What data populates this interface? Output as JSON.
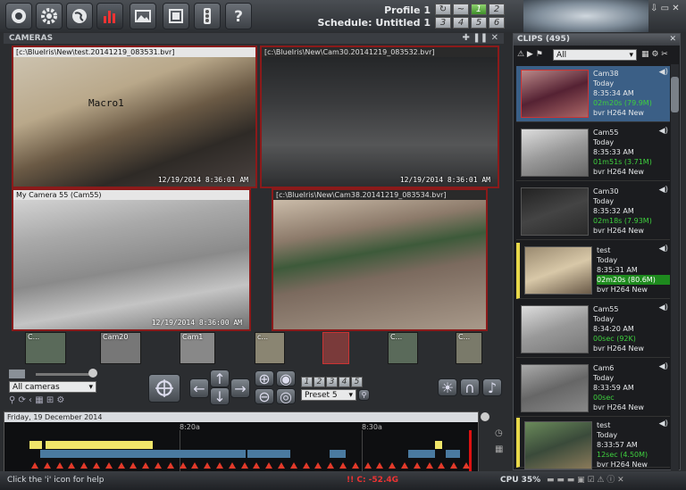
{
  "header": {
    "profile": "Profile 1",
    "schedule": "Schedule: Untitled 1",
    "profile_numbers": [
      "1",
      "2",
      "3",
      "4",
      "5",
      "6",
      "7"
    ],
    "toolbar_icons": [
      "camera-icon",
      "gear-icon",
      "globe-icon",
      "chart-icon",
      "image-icon",
      "film-icon",
      "traffic-light-icon",
      "help-icon"
    ]
  },
  "cameras": {
    "title": "CAMERAS",
    "tiles": [
      {
        "title": "[c:\\BlueIris\\New\\test.20141219_083531.bvr]",
        "stamp": "12/19/2014 8:36:01 AM",
        "overlay": "Macro1"
      },
      {
        "title": "[c:\\BlueIris\\New\\Cam30.20141219_083532.bvr]",
        "stamp": "12/19/2014 8:36:01 AM",
        "overlay": ""
      },
      {
        "title": "My Camera 55 (Cam55)",
        "stamp": "12/19/2014 8:36:00 AM",
        "overlay": ""
      },
      {
        "title": "[c:\\BlueIris\\New\\Cam38.20141219_083534.bvr]",
        "stamp": "",
        "overlay": ""
      }
    ],
    "thumbs": [
      "C...",
      "Cam20",
      "Cam1",
      "c...",
      "",
      "",
      "C...",
      "C..."
    ]
  },
  "controls": {
    "group_select": "All cameras",
    "preset_select": "Preset 5",
    "preset_numbers": [
      "1",
      "2",
      "3",
      "4",
      "5"
    ]
  },
  "timeline": {
    "date": "Friday, 19 December 2014",
    "tick_a": "8:20a",
    "tick_b": "8:30a"
  },
  "clips": {
    "title": "CLIPS",
    "count": "(495)",
    "filter": "All",
    "items": [
      {
        "cam": "Cam38",
        "day": "Today",
        "time": "8:35:34 AM",
        "dur": "02m20s (79.9M)",
        "fmt": "bvr H264 New"
      },
      {
        "cam": "Cam55",
        "day": "Today",
        "time": "8:35:33 AM",
        "dur": "01m51s (3.71M)",
        "fmt": "bvr H264 New"
      },
      {
        "cam": "Cam30",
        "day": "Today",
        "time": "8:35:32 AM",
        "dur": "02m18s (7.93M)",
        "fmt": "bvr H264 New"
      },
      {
        "cam": "test",
        "day": "Today",
        "time": "8:35:31 AM",
        "dur": "02m20s (80.6M)",
        "fmt": "bvr H264 New"
      },
      {
        "cam": "Cam55",
        "day": "Today",
        "time": "8:34:20 AM",
        "dur": "00sec (92K)",
        "fmt": "bvr H264 New"
      },
      {
        "cam": "Cam6",
        "day": "Today",
        "time": "8:33:59 AM",
        "dur": "00sec",
        "fmt": "bvr H264 New"
      },
      {
        "cam": "test",
        "day": "Today",
        "time": "8:33:57 AM",
        "dur": "12sec (4.50M)",
        "fmt": "bvr H264 New"
      }
    ]
  },
  "status": {
    "help": "Click the 'i' icon for help",
    "center": "!! C: -52.4G",
    "cpu": "CPU 35%"
  }
}
